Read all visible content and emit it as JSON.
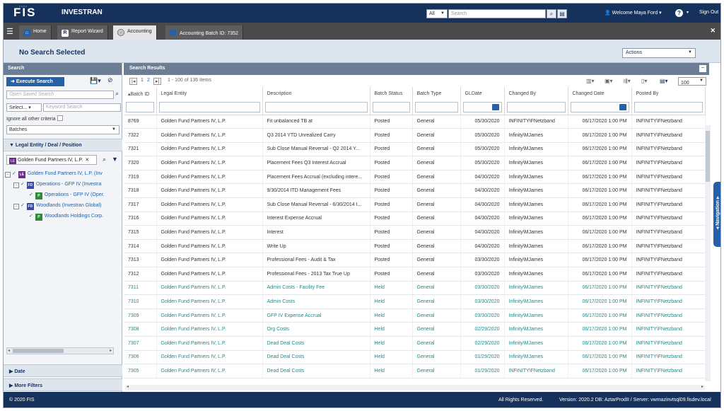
{
  "header": {
    "logo_small": "•••••",
    "logo": "FIS",
    "app_name": "INVESTRAN",
    "search_scope": "All",
    "search_placeholder": "Search",
    "welcome": "Welcome Maya Ford",
    "help": "?",
    "signout": "Sign Out"
  },
  "tabs": [
    {
      "label": "Home"
    },
    {
      "label": "Report Wizard"
    },
    {
      "label": "Accounting"
    },
    {
      "label": "Accounting Batch ID: 7352"
    }
  ],
  "page": {
    "title": "No Search Selected",
    "actions": "Actions"
  },
  "search_panel": {
    "title": "Search",
    "execute": "Execute Search",
    "saved_search_placeholder": "Open Saved Search",
    "select": "Select...",
    "keyword_placeholder": "Keyword Search",
    "ignore_label": "Ignore all other criteria",
    "batches": "Batches",
    "section_entity": "Legal Entity / Deal / Position",
    "chip_badge": "LE",
    "chip_label": "Golden Fund Partners IV, L.P.",
    "tree": [
      {
        "badge": "LE",
        "label": "Golden Fund Partners IV, L.P. (Inv",
        "color": "#6a2b8a"
      },
      {
        "badge": "FD",
        "label": "Operations - GFP IV (Investra",
        "color": "#3b4a9e"
      },
      {
        "badge": "P",
        "label": "Operations - GFP IV (Oper.",
        "color": "#2e8b3a"
      },
      {
        "badge": "FD",
        "label": "Woodlands (Investran Global)",
        "color": "#3b4a9e"
      },
      {
        "badge": "P",
        "label": "Woodlands Holdings Corp.",
        "color": "#2e8b3a"
      }
    ],
    "section_date": "Date",
    "section_more": "More Filters"
  },
  "results": {
    "title": "Search Results",
    "pager_pages": [
      "1",
      "2"
    ],
    "pager_info": "1 - 100 of 136 items",
    "page_size": "100",
    "columns": [
      "Batch ID",
      "Legal Entity",
      "Description",
      "Batch Status",
      "Batch Type",
      "GLDate",
      "Changed By",
      "Changed Date",
      "Posted By"
    ],
    "rows": [
      [
        "8769",
        "Golden Fund Partners IV, L.P.",
        "Fit unbalanced TB at",
        "Posted",
        "General",
        "05/30/2020",
        "INFINITY\\FNetzband",
        "06/17/2020 1:00 PM",
        "INFINITY\\FNetzband"
      ],
      [
        "7322",
        "Golden Fund Partners IV, L.P.",
        "Q3 2014 YTD Unrealized Carry",
        "Posted",
        "General",
        "05/30/2020",
        "Infinity\\MJames",
        "06/17/2020 1:00 PM",
        "INFINITY\\FNetzband"
      ],
      [
        "7321",
        "Golden Fund Partners IV, L.P.",
        "Sub Close Manual Reversal - Q2 2014 Y...",
        "Posted",
        "General",
        "05/30/2020",
        "Infinity\\MJames",
        "06/17/2020 1:00 PM",
        "INFINITY\\FNetzband"
      ],
      [
        "7320",
        "Golden Fund Partners IV, L.P.",
        "Placement Fees Q3 Interest Accrual",
        "Posted",
        "General",
        "05/30/2020",
        "Infinity\\MJames",
        "06/17/2020 1:00 PM",
        "INFINITY\\FNetzband"
      ],
      [
        "7319",
        "Golden Fund Partners IV, L.P.",
        "Placement Fees Accrual (excluding intere...",
        "Posted",
        "General",
        "04/30/2020",
        "Infinity\\MJames",
        "06/17/2020 1:00 PM",
        "INFINITY\\FNetzband"
      ],
      [
        "7318",
        "Golden Fund Partners IV, L.P.",
        "9/30/2014 ITD Management Fees",
        "Posted",
        "General",
        "04/30/2020",
        "Infinity\\MJames",
        "06/17/2020 1:00 PM",
        "INFINITY\\FNetzband"
      ],
      [
        "7317",
        "Golden Fund Partners IV, L.P.",
        "Sub Close Manual Reversal - 6/30/2014 I...",
        "Posted",
        "General",
        "04/30/2020",
        "Infinity\\MJames",
        "06/17/2020 1:00 PM",
        "INFINITY\\FNetzband"
      ],
      [
        "7316",
        "Golden Fund Partners IV, L.P.",
        "Interest Expense Accrual",
        "Posted",
        "General",
        "04/30/2020",
        "Infinity\\MJames",
        "06/17/2020 1:00 PM",
        "INFINITY\\FNetzband"
      ],
      [
        "7315",
        "Golden Fund Partners IV, L.P.",
        "Interest",
        "Posted",
        "General",
        "04/30/2020",
        "Infinity\\MJames",
        "06/17/2020 1:00 PM",
        "INFINITY\\FNetzband"
      ],
      [
        "7314",
        "Golden Fund Partners IV, L.P.",
        "Write Up",
        "Posted",
        "General",
        "04/30/2020",
        "Infinity\\MJames",
        "06/17/2020 1:00 PM",
        "INFINITY\\FNetzband"
      ],
      [
        "7313",
        "Golden Fund Partners IV, L.P.",
        "Professional Fees - Audit & Tax",
        "Posted",
        "General",
        "03/30/2020",
        "Infinity\\MJames",
        "06/17/2020 1:00 PM",
        "INFINITY\\FNetzband"
      ],
      [
        "7312",
        "Golden Fund Partners IV, L.P.",
        "Professional Fees - 2013 Tax True Up",
        "Posted",
        "General",
        "03/30/2020",
        "Infinity\\MJames",
        "06/17/2020 1:00 PM",
        "INFINITY\\FNetzband"
      ],
      [
        "7311",
        "Golden Fund Partners IV, L.P.",
        "Admin Costs - Facility Fee",
        "Held",
        "General",
        "03/30/2020",
        "Infinity\\MJames",
        "06/17/2020 1:00 PM",
        "INFINITY\\FNetzband"
      ],
      [
        "7310",
        "Golden Fund Partners IV, L.P.",
        "Admin Costs",
        "Held",
        "General",
        "03/30/2020",
        "Infinity\\MJames",
        "06/17/2020 1:00 PM",
        "INFINITY\\FNetzband"
      ],
      [
        "7309",
        "Golden Fund Partners IV, L.P.",
        "GFP IV Expense Accrual",
        "Held",
        "General",
        "03/30/2020",
        "Infinity\\MJames",
        "06/17/2020 1:00 PM",
        "INFINITY\\FNetzband"
      ],
      [
        "7308",
        "Golden Fund Partners IV, L.P.",
        "Org Costs",
        "Held",
        "General",
        "02/29/2020",
        "Infinity\\MJames",
        "06/17/2020 1:00 PM",
        "INFINITY\\FNetzband"
      ],
      [
        "7307",
        "Golden Fund Partners IV, L.P.",
        "Dead Deal Costs",
        "Held",
        "General",
        "02/29/2020",
        "Infinity\\MJames",
        "06/17/2020 1:00 PM",
        "INFINITY\\FNetzband"
      ],
      [
        "7306",
        "Golden Fund Partners IV, L.P.",
        "Dead Deal Costs",
        "Held",
        "General",
        "01/29/2020",
        "Infinity\\MJames",
        "06/17/2020 1:00 PM",
        "INFINITY\\FNetzband"
      ],
      [
        "7305",
        "Golden Fund Partners IV, L.P.",
        "Dead Deal Costs",
        "Held",
        "General",
        "01/29/2020",
        "INFINITY\\FNetzband",
        "06/17/2020 1:00 PM",
        "INFINITY\\FNetzband"
      ]
    ]
  },
  "nav_tab": "Navigation",
  "footer": {
    "copyright": "© 2020 FIS",
    "rights": "All Rights Reserved.",
    "version": "Version: 2020.2  DB: AztarProdII / Server: vwmazinvtsql09.fisdev.local"
  },
  "colors": {
    "brand": "#16325c",
    "accent": "#2461a8",
    "held_text": "#1f8a8a"
  }
}
